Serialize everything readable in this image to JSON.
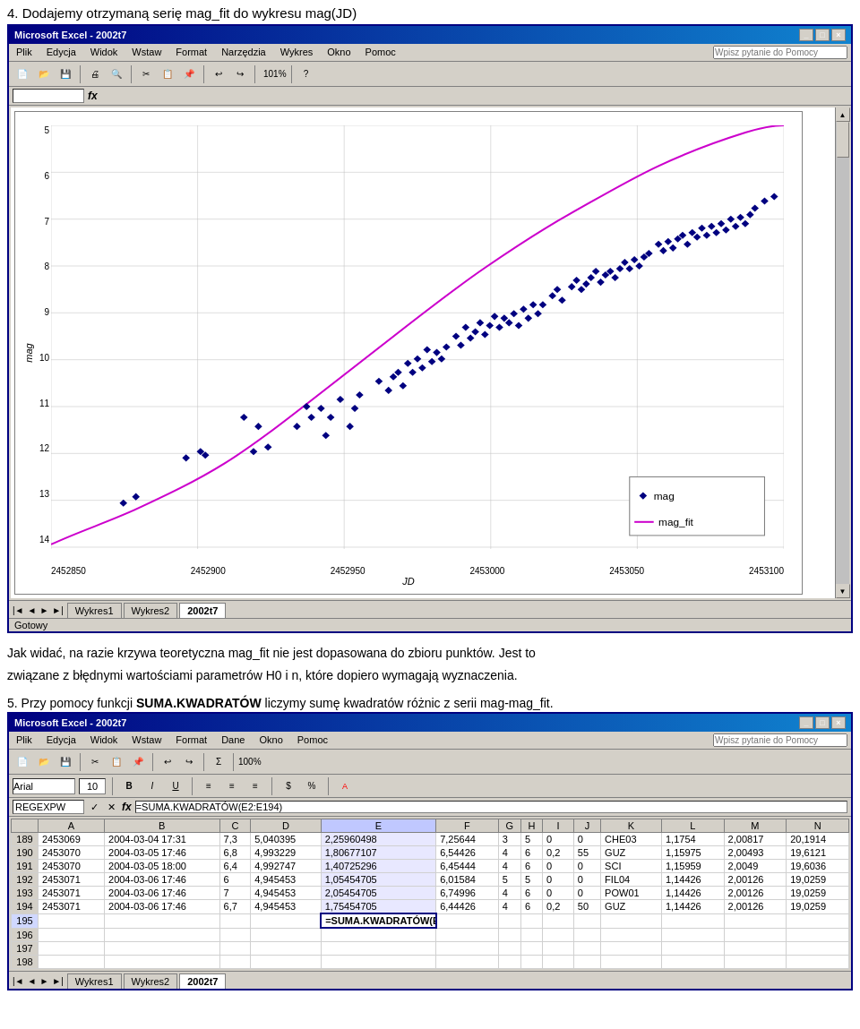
{
  "page": {
    "heading": "4. Dodajemy otrzymaną serię mag_fit do wykresu mag(JD)"
  },
  "excel1": {
    "title": "Microsoft Excel - 2002t7",
    "menu": [
      "Plik",
      "Edycja",
      "Widok",
      "Wstaw",
      "Format",
      "Narzędzia",
      "Wykres",
      "Okno",
      "Pomoc"
    ],
    "help_placeholder": "Wpisz pytanie do Pomocy",
    "formula_content": "",
    "chart": {
      "x_label": "JD",
      "y_label": "mag",
      "x_axis": [
        "2452850",
        "2452900",
        "2452950",
        "2453000",
        "2453050",
        "2453100"
      ],
      "y_axis": [
        "5",
        "6",
        "7",
        "8",
        "9",
        "10",
        "11",
        "12",
        "13",
        "14"
      ],
      "legend": [
        {
          "symbol": "◆",
          "label": "mag"
        },
        {
          "symbol": "—",
          "label": "mag_fit"
        }
      ]
    },
    "sheets": [
      "Wykres1",
      "Wykres2",
      "2002t7"
    ],
    "active_sheet": "2002t7",
    "status": "Gotowy"
  },
  "body_text1": "Jak widać, na razie krzywa teoretyczna mag_fit nie jest dopasowana do zbioru punktów. Jest to",
  "body_text2": "związane z błędnymi wartościami parametrów H0 i n, które dopiero wymagają wyznaczenia.",
  "section5_heading": "5. Przy pomocy funkcji SUMA.KWADRATÓW liczymy sumę kwadratów różnic z serii mag-mag_fit.",
  "excel2": {
    "title": "Microsoft Excel - 2002t7",
    "menu": [
      "Plik",
      "Edycja",
      "Widok",
      "Wstaw",
      "Format",
      "Dane",
      "Okno",
      "Pomoc"
    ],
    "help_placeholder": "Wpisz pytanie do Pomocy",
    "name_box": "REGEXPW",
    "formula_bar": "=SUMA.KWADRATÓW(E2:E194)",
    "font": "Arial",
    "size": "10",
    "columns": [
      "A",
      "B",
      "C",
      "D",
      "E",
      "F",
      "G",
      "H",
      "I",
      "J",
      "K",
      "L",
      "M",
      "N"
    ],
    "rows": [
      {
        "num": "189",
        "cells": [
          "2453069",
          "2004-03-04 17:31",
          "7,3",
          "5,040395",
          "2,25960498",
          "7,25644",
          "3",
          "5",
          "0",
          "0",
          "CHE03",
          "1,1754",
          "2,00817",
          "20,1914"
        ]
      },
      {
        "num": "190",
        "cells": [
          "2453070",
          "2004-03-05 17:46",
          "6,8",
          "4,993229",
          "1,80677107",
          "6,54426",
          "4",
          "6",
          "0,2",
          "55",
          "GUZ",
          "1,15975",
          "2,00493",
          "19,6121"
        ]
      },
      {
        "num": "191",
        "cells": [
          "2453070",
          "2004-03-05 18:00",
          "6,4",
          "4,992747",
          "1,40725296",
          "6,45444",
          "4",
          "6",
          "0",
          "0",
          "SCI",
          "1,15959",
          "2,0049",
          "19,6036"
        ]
      },
      {
        "num": "192",
        "cells": [
          "2453071",
          "2004-03-06 17:46",
          "6",
          "4,945453",
          "1,05454705",
          "6,01584",
          "5",
          "5",
          "0",
          "0",
          "FIL04",
          "1,14426",
          "2,00126",
          "19,0259"
        ]
      },
      {
        "num": "193",
        "cells": [
          "2453071",
          "2004-03-06 17:46",
          "7",
          "4,945453",
          "2,05454705",
          "6,74996",
          "4",
          "6",
          "0",
          "0",
          "POW01",
          "1,14426",
          "2,00126",
          "19,0259"
        ]
      },
      {
        "num": "194",
        "cells": [
          "2453071",
          "2004-03-06 17:46",
          "6,7",
          "4,945453",
          "1,75454705",
          "6,44426",
          "4",
          "6",
          "0,2",
          "50",
          "GUZ",
          "1,14426",
          "2,00126",
          "19,0259"
        ]
      },
      {
        "num": "195",
        "cells": [
          "",
          "",
          "",
          "",
          "=SUMA.KWADRATÓW(E2:E194)",
          "",
          "",
          "",
          "",
          "",
          "",
          "",
          "",
          ""
        ]
      },
      {
        "num": "196",
        "cells": [
          "",
          "",
          "",
          "",
          "",
          "",
          "",
          "",
          "",
          "",
          "",
          "",
          "",
          ""
        ]
      },
      {
        "num": "197",
        "cells": [
          "",
          "",
          "",
          "",
          "",
          "",
          "",
          "",
          "",
          "",
          "",
          "",
          "",
          ""
        ]
      },
      {
        "num": "198",
        "cells": [
          "",
          "",
          "",
          "",
          "",
          "",
          "",
          "",
          "",
          "",
          "",
          "",
          "",
          ""
        ]
      }
    ],
    "sheets": [
      "Wykres1",
      "Wykres2",
      "2002t7"
    ],
    "active_sheet": "2002t7",
    "status": ""
  }
}
